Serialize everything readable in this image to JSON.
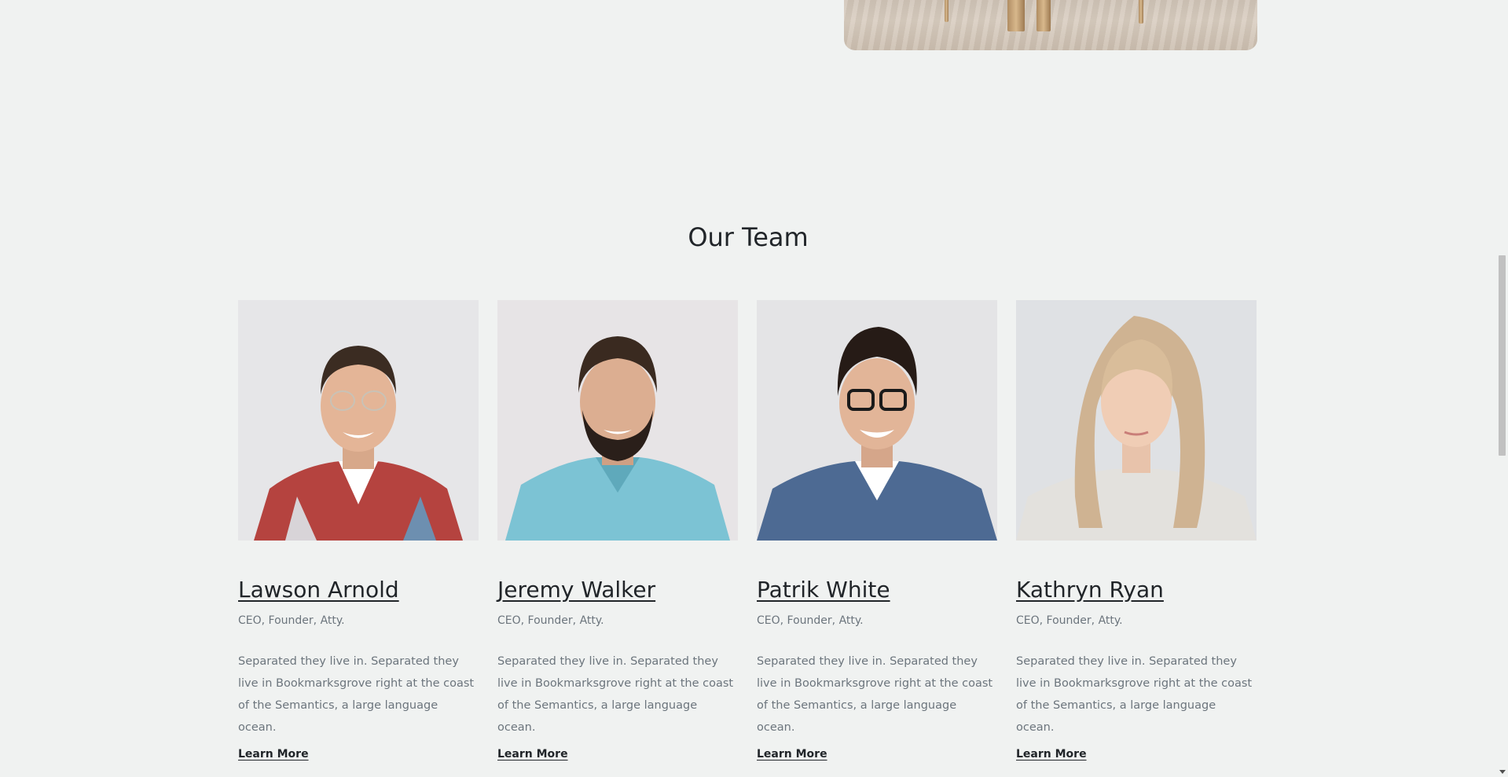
{
  "hero": {
    "image_name": "furniture-photo"
  },
  "team": {
    "title": "Our Team",
    "members": [
      {
        "name": "Lawson Arnold",
        "role": "CEO, Founder, Atty.",
        "description": "Separated they live in. Separated they live in Bookmarksgrove right at the coast of the Semantics, a large language ocean.",
        "link": "Learn More"
      },
      {
        "name": "Jeremy Walker",
        "role": "CEO, Founder, Atty.",
        "description": "Separated they live in. Separated they live in Bookmarksgrove right at the coast of the Semantics, a large language ocean.",
        "link": "Learn More"
      },
      {
        "name": "Patrik White",
        "role": "CEO, Founder, Atty.",
        "description": "Separated they live in. Separated they live in Bookmarksgrove right at the coast of the Semantics, a large language ocean.",
        "link": "Learn More"
      },
      {
        "name": "Kathryn Ryan",
        "role": "CEO, Founder, Atty.",
        "description": "Separated they live in. Separated they live in Bookmarksgrove right at the coast of the Semantics, a large language ocean.",
        "link": "Learn More"
      }
    ]
  },
  "colors": {
    "background": "#f0f2f1",
    "heading": "#212529",
    "muted_text": "#6c757d"
  }
}
